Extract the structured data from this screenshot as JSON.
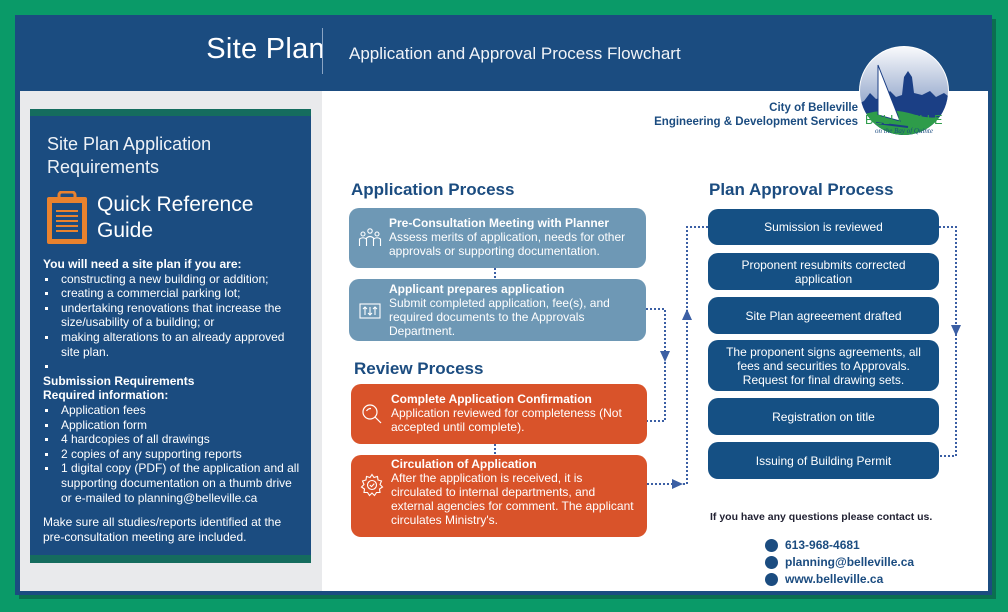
{
  "header": {
    "title": "Site Plan",
    "subtitle": "Application and Approval Process Flowchart"
  },
  "organization": {
    "line1": "City of Belleville",
    "line2": "Engineering & Development Services",
    "logo_text": "BELLEVILLE",
    "logo_tagline": "on the Bay of Quinte"
  },
  "guide": {
    "title_line1": "Site Plan Application",
    "title_line2": "Requirements",
    "qrg_line1": "Quick Reference",
    "qrg_line2": "Guide",
    "need_heading": "You will need a site plan if you are:",
    "need_items": [
      "constructing a new building or addition;",
      "creating a commercial parking lot;",
      "undertaking renovations that increase the size/usability of a building; or",
      "making alterations to an already approved site plan.",
      ""
    ],
    "submission_heading": "Submission Requirements",
    "required_heading": "Required information:",
    "required_items": [
      "Application fees",
      "Application form",
      "4 hardcopies of all drawings",
      "2 copies of any supporting reports",
      "1 digital copy (PDF) of the application and all supporting documentation on a thumb drive or e-mailed to planning@belleville.ca"
    ],
    "note": "Make sure all studies/reports identified at the pre-consultation meeting are included."
  },
  "application_process": {
    "heading": "Application Process",
    "steps": [
      {
        "title": "Pre-Consultation Meeting with Planner",
        "body": "Assess merits of application, needs for other approvals or supporting documentation.",
        "icon": "people-group-icon"
      },
      {
        "title": "Applicant prepares application",
        "body": "Submit completed application, fee(s), and required documents to the Approvals Department.",
        "icon": "documents-upload-icon"
      }
    ]
  },
  "review_process": {
    "heading": "Review Process",
    "steps": [
      {
        "title": "Complete Application Confirmation",
        "body": "Application reviewed for completeness (Not accepted until complete).",
        "icon": "magnifier-icon"
      },
      {
        "title": "Circulation of Application",
        "body": "After the application is received, it is circulated to internal departments, and external agencies for comment. The applicant circulates Ministry's.",
        "icon": "gear-check-icon"
      }
    ]
  },
  "plan_approval_process": {
    "heading": "Plan Approval Process",
    "steps": [
      "Sumission is reviewed",
      "Proponent resubmits corrected application",
      "Site Plan agreeement drafted",
      "The proponent signs agreements, all fees and securities to Approvals. Request for final drawing sets.",
      "Registration on title",
      "Issuing of Building Permit"
    ]
  },
  "contact": {
    "prompt": "If you have any questions please contact us.",
    "phone": "613-968-4681",
    "email": "planning@belleville.ca",
    "website": "www.belleville.ca"
  },
  "colors": {
    "border_green": "#0a9a68",
    "navy": "#1b4c80",
    "app_blue": "#6e98b5",
    "review_orange": "#d9532a",
    "plan_blue": "#155084",
    "clipboard_orange": "#e9822e"
  }
}
